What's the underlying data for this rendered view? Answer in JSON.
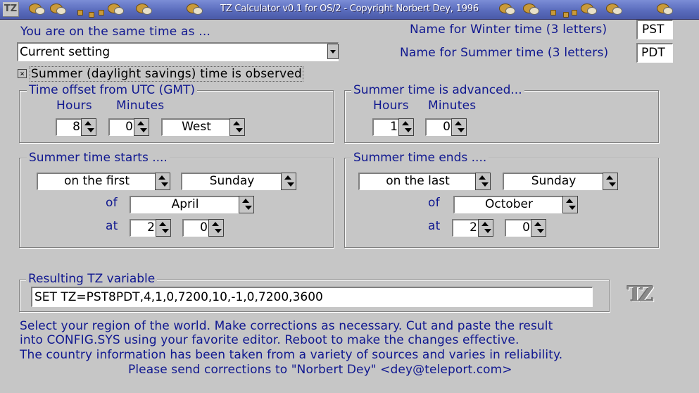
{
  "window": {
    "title": "TZ Calculator v0.1 for OS/2 - Copyright Norbert Dey, 1996",
    "sys_icon": "TZ"
  },
  "same_time": {
    "label": "You are on the same time as ...",
    "selected": "Current setting"
  },
  "names": {
    "winter_label": "Name for Winter time (3 letters)",
    "winter_value": "PST",
    "summer_label": "Name for Summer time (3 letters)",
    "summer_value": "PDT"
  },
  "dst": {
    "checkbox_label": "Summer (daylight savings) time is observed",
    "checked": true,
    "check_glyph": "×"
  },
  "offset": {
    "title": "Time offset from UTC (GMT)",
    "hours_label": "Hours",
    "minutes_label": "Minutes",
    "hours": "8",
    "minutes": "0",
    "direction": "West"
  },
  "advanced": {
    "title": "Summer time is advanced...",
    "hours_label": "Hours",
    "minutes_label": "Minutes",
    "hours": "1",
    "minutes": "0"
  },
  "starts": {
    "title": "Summer time starts ....",
    "week": "on the first",
    "day": "Sunday",
    "of_label": "of",
    "month": "April",
    "at_label": "at",
    "hour": "2",
    "minute": "0"
  },
  "ends": {
    "title": "Summer time ends ....",
    "week": "on the last",
    "day": "Sunday",
    "of_label": "of",
    "month": "October",
    "at_label": "at",
    "hour": "2",
    "minute": "0"
  },
  "result": {
    "title": "Resulting TZ variable",
    "value": "SET TZ=PST8PDT,4,1,0,7200,10,-1,0,7200,3600"
  },
  "logo_text": "TZ",
  "info": {
    "line1": "Select your region of the world. Make corrections as necessary. Cut and paste the result",
    "line2": "into CONFIG.SYS using your favorite editor.  Reboot to make the changes effective.",
    "line3": "The country information has been taken from a variety of sources and varies in reliability.",
    "line4": "Please send corrections to \"Norbert Dey\" <dey@teleport.com>"
  },
  "colors": {
    "label_blue": "#101890",
    "background": "#c6c6c6",
    "title_bar": "#5a6cbd"
  }
}
